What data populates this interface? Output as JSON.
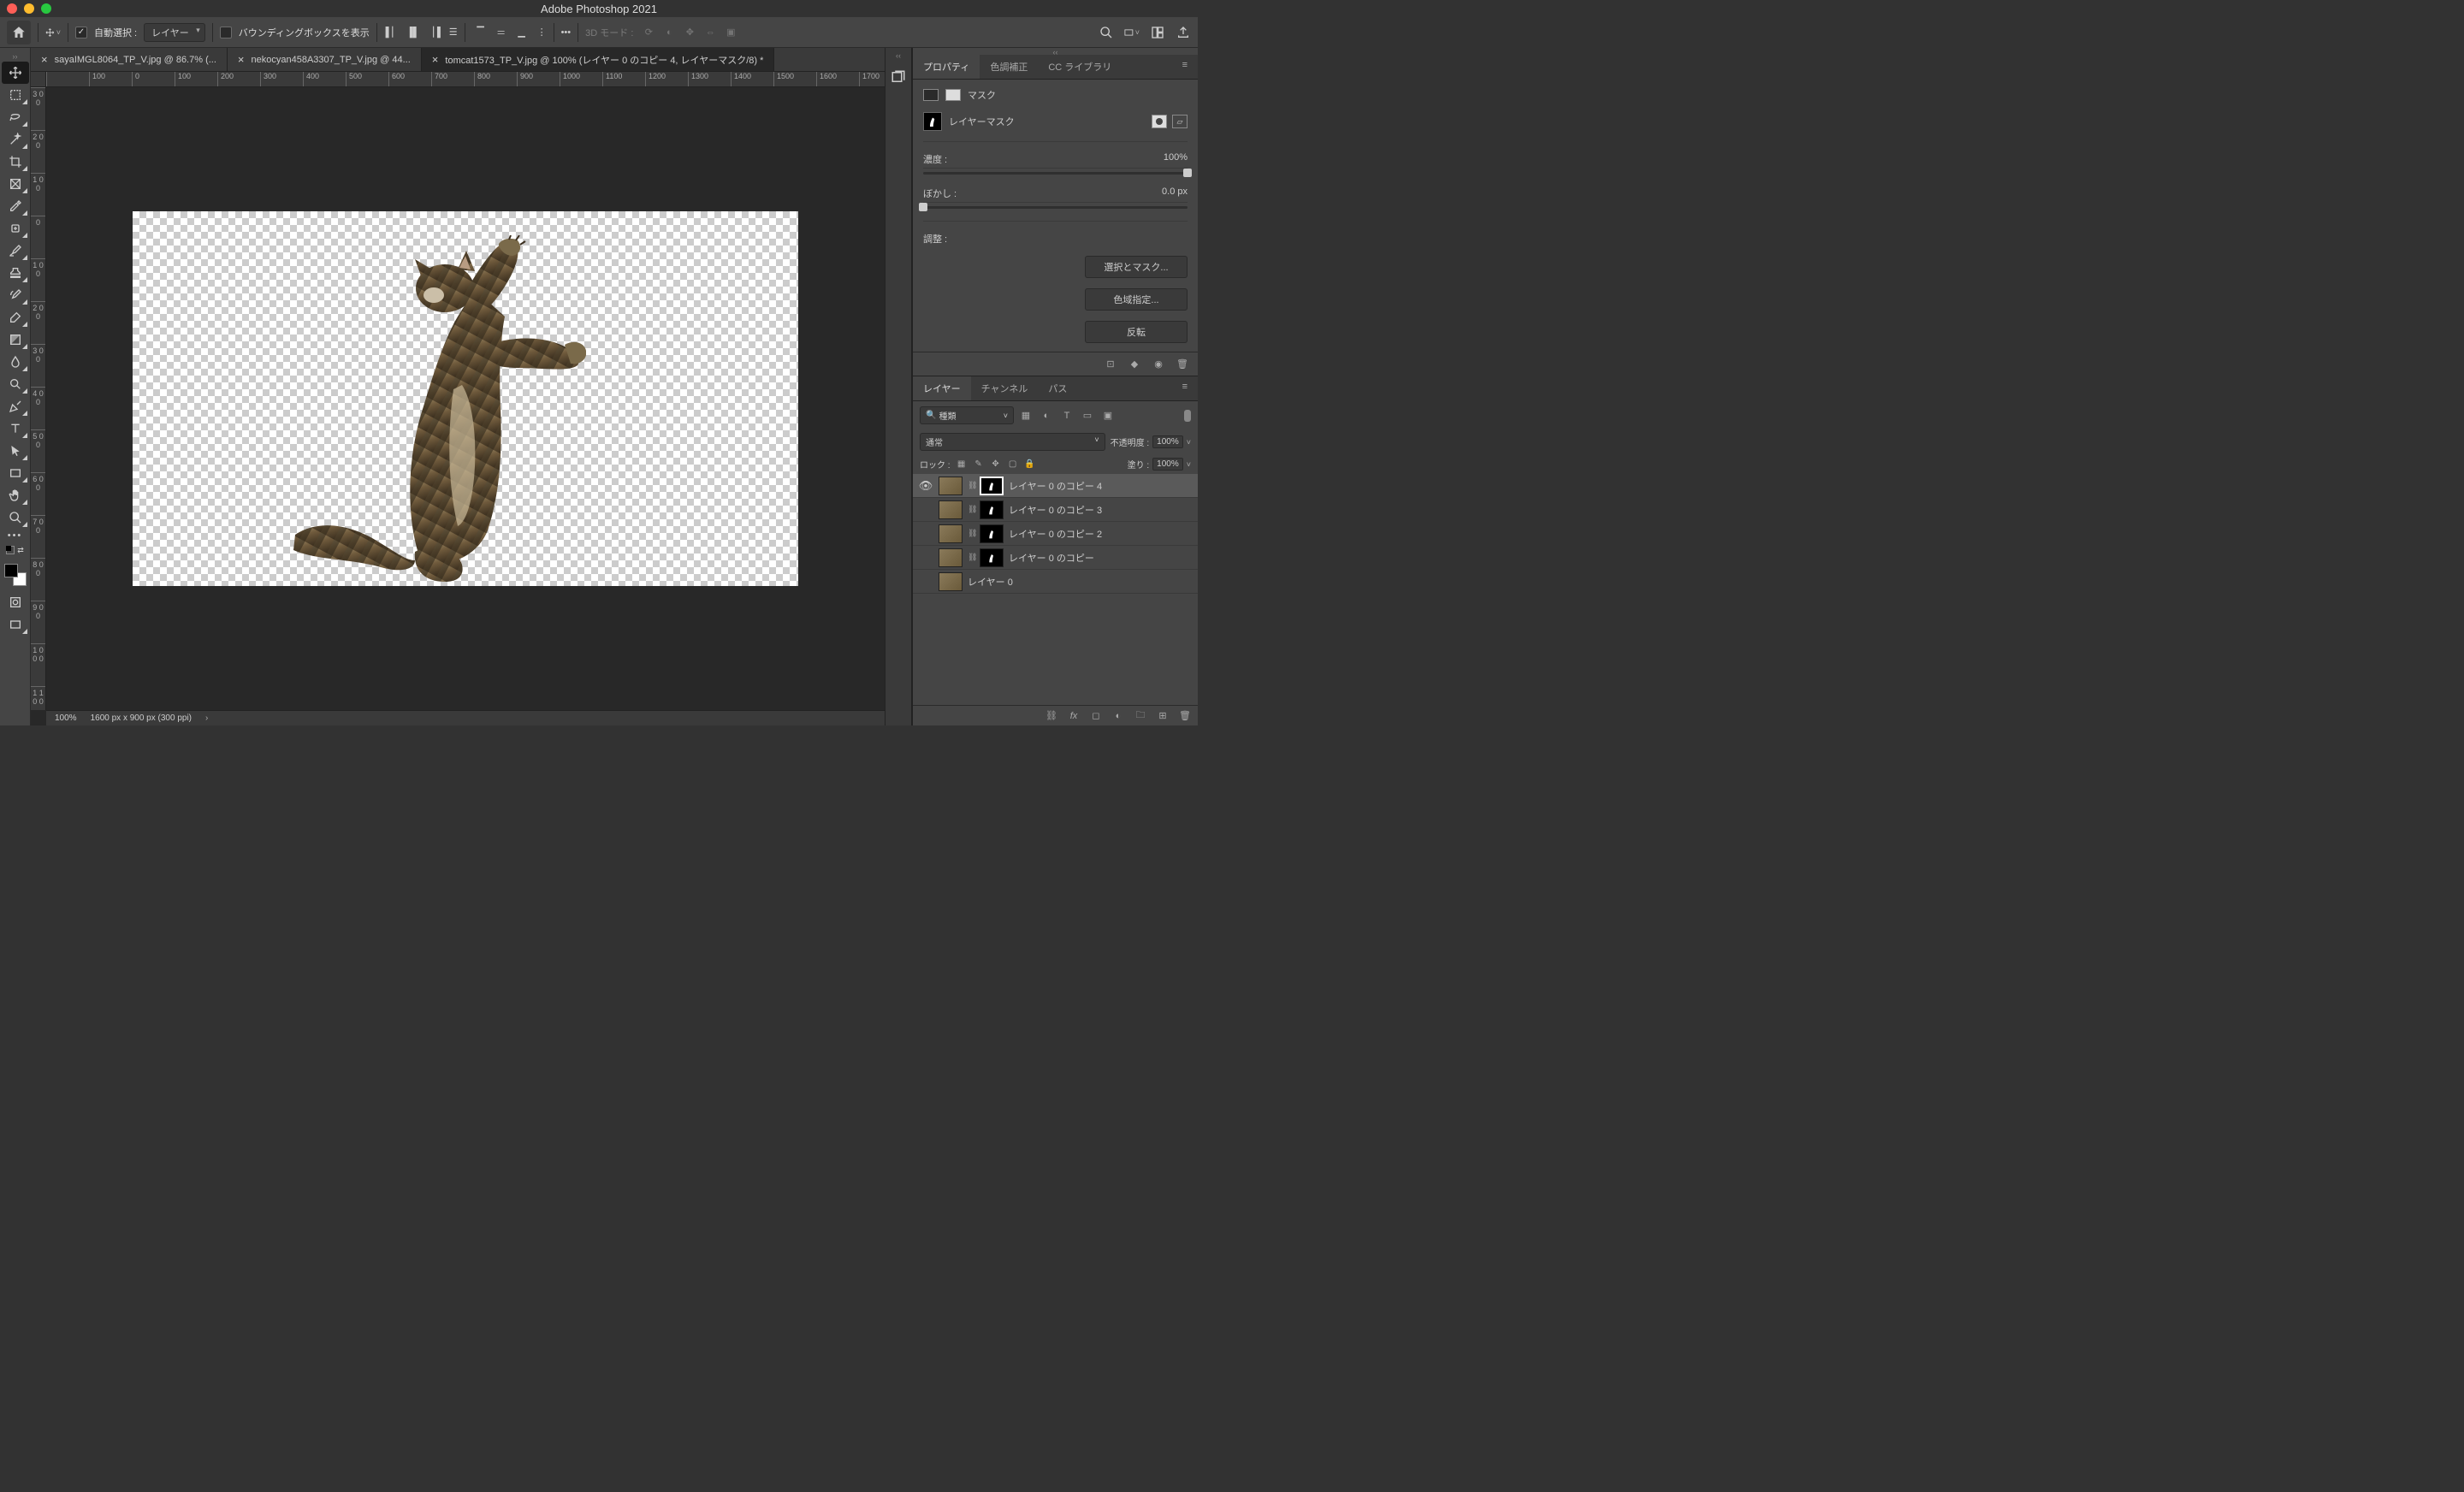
{
  "app_title": "Adobe Photoshop 2021",
  "options_bar": {
    "auto_select_label": "自動選択 :",
    "auto_select_target": "レイヤー",
    "bounding_box_label": "バウンディングボックスを表示",
    "mode_3d_label": "3D モード :"
  },
  "doc_tabs": [
    {
      "title": "sayaIMGL8064_TP_V.jpg @ 86.7% (...",
      "active": false
    },
    {
      "title": "nekocyan458A3307_TP_V.jpg @ 44...",
      "active": false
    },
    {
      "title": "tomcat1573_TP_V.jpg @ 100% (レイヤー 0 のコピー 4, レイヤーマスク/8) *",
      "active": true
    }
  ],
  "ruler_h": [
    "",
    "100",
    "0",
    "100",
    "200",
    "300",
    "400",
    "500",
    "600",
    "700",
    "800",
    "900",
    "1000",
    "1100",
    "1200",
    "1300",
    "1400",
    "1500",
    "1600",
    "1700"
  ],
  "ruler_v": [
    "300",
    "200",
    "100",
    "0",
    "100",
    "200",
    "300",
    "400",
    "500",
    "600",
    "700",
    "800",
    "900",
    "1000",
    "1100"
  ],
  "status_bar": {
    "zoom": "100%",
    "doc": "1600 px x 900 px (300 ppi)"
  },
  "properties": {
    "tab_properties": "プロパティ",
    "tab_color": "色調補正",
    "tab_cc": "CC ライブラリ",
    "section_mask": "マスク",
    "mask_type": "レイヤーマスク",
    "density_label": "濃度 :",
    "density_value": "100%",
    "feather_label": "ぼかし :",
    "feather_value": "0.0 px",
    "refine_label": "調整 :",
    "btn_select_mask": "選択とマスク...",
    "btn_color_range": "色域指定...",
    "btn_invert": "反転"
  },
  "layers": {
    "tab_layers": "レイヤー",
    "tab_channels": "チャンネル",
    "tab_paths": "パス",
    "filter_kind": "種類",
    "blend_mode": "通常",
    "opacity_label": "不透明度 :",
    "opacity_value": "100%",
    "lock_label": "ロック :",
    "fill_label": "塗り :",
    "fill_value": "100%",
    "items": [
      {
        "name": "レイヤー 0 のコピー 4",
        "visible": true,
        "has_mask": true,
        "selected": true,
        "mask_selected": true
      },
      {
        "name": "レイヤー 0 のコピー 3",
        "visible": false,
        "has_mask": true,
        "selected": false
      },
      {
        "name": "レイヤー 0 のコピー 2",
        "visible": false,
        "has_mask": true,
        "selected": false
      },
      {
        "name": "レイヤー 0 のコピー",
        "visible": false,
        "has_mask": true,
        "selected": false
      },
      {
        "name": "レイヤー 0",
        "visible": false,
        "has_mask": false,
        "selected": false
      }
    ]
  }
}
